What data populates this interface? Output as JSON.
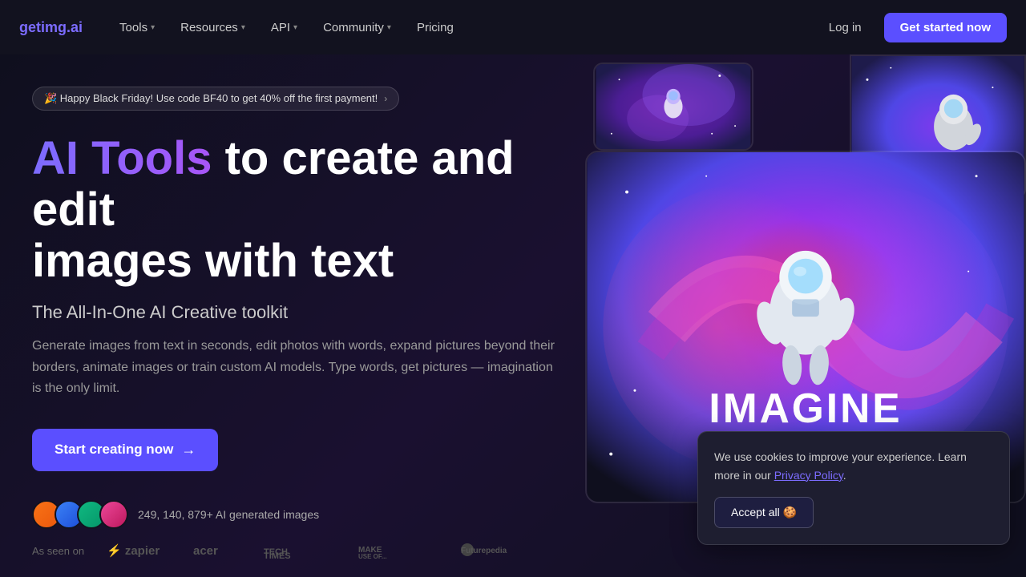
{
  "nav": {
    "logo": "getimg",
    "logo_dot": ".",
    "logo_suffix": "ai",
    "links": [
      {
        "label": "Tools",
        "has_chevron": true
      },
      {
        "label": "Resources",
        "has_chevron": true
      },
      {
        "label": "API",
        "has_chevron": true
      },
      {
        "label": "Community",
        "has_chevron": true
      },
      {
        "label": "Pricing",
        "has_chevron": false
      }
    ],
    "login_label": "Log in",
    "cta_label": "Get started now"
  },
  "hero": {
    "promo_text": "🎉 Happy Black Friday! Use code BF40 to get 40% off the first payment!",
    "heading_gradient": "AI Tools",
    "heading_rest": " to create and edit images with text",
    "subtitle": "The All-In-One AI Creative toolkit",
    "description": "Generate images from text in seconds, edit photos with words, expand pictures beyond their borders, animate images or train custom AI models. Type words, get pictures — imagination is the only limit.",
    "cta_label": "Start creating now",
    "social_proof_text": "249, 140, 879+ AI generated images"
  },
  "as_seen_on": {
    "label": "As seen on",
    "brands": [
      "zapier",
      "acer",
      "TECH TIMES",
      "MAKE USE OF...",
      "Futurepedia"
    ]
  },
  "cookie": {
    "text": "We use cookies to improve your experience. Learn more in our ",
    "link_text": "Privacy Policy",
    "accept_label": "Accept all 🍪"
  },
  "colors": {
    "accent": "#5b4fff",
    "gradient_from": "#7c6cff",
    "gradient_to": "#a855f7"
  }
}
